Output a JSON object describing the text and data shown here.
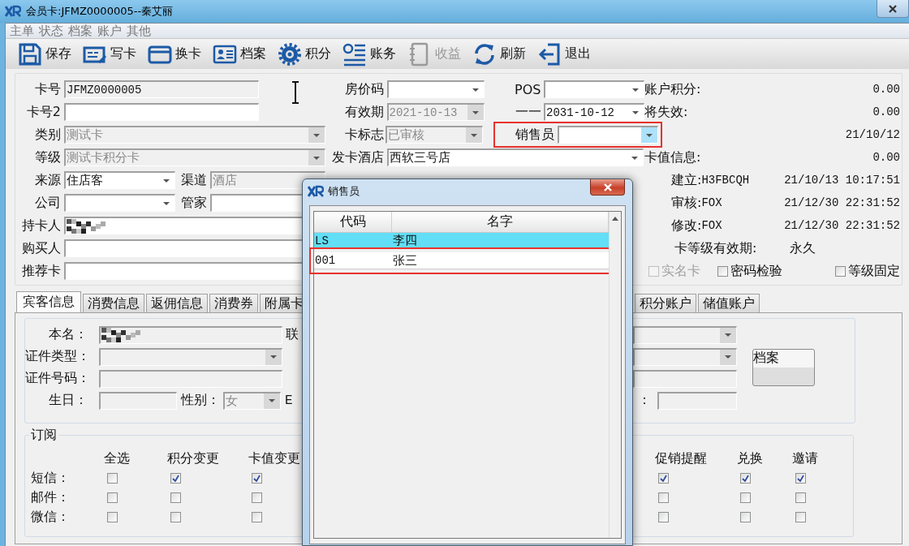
{
  "window": {
    "title": "会员卡:JFMZ0000005--秦艾丽"
  },
  "menu": [
    "主单",
    "状态",
    "档案",
    "账户",
    "其他"
  ],
  "toolbar": [
    {
      "label": "保存",
      "kind": "save",
      "disabled": false
    },
    {
      "label": "写卡",
      "kind": "write",
      "disabled": false
    },
    {
      "label": "换卡",
      "kind": "card",
      "disabled": false
    },
    {
      "label": "档案",
      "kind": "profile",
      "disabled": false
    },
    {
      "label": "积分",
      "kind": "points",
      "disabled": false
    },
    {
      "label": "账务",
      "kind": "ledger",
      "disabled": false
    },
    {
      "label": "收益",
      "kind": "income",
      "disabled": true
    },
    {
      "label": "刷新",
      "kind": "refresh",
      "disabled": false
    },
    {
      "label": "退出",
      "kind": "exit",
      "disabled": false
    }
  ],
  "form": {
    "card_no": {
      "label": "卡号",
      "value": "JFMZ0000005",
      "readonly": true
    },
    "card_no2": {
      "label": "卡号2"
    },
    "category": {
      "label": "类别",
      "value": "测试卡",
      "disabled": true
    },
    "grade": {
      "label": "等级",
      "value": "测试卡积分卡",
      "disabled": true
    },
    "source": {
      "label": "来源",
      "value": "住店客"
    },
    "channel": {
      "label": "渠道",
      "value": "酒店",
      "disabled": true
    },
    "company": {
      "label": "公司"
    },
    "butler": {
      "label": "管家"
    },
    "holder": {
      "label": "持卡人",
      "redacted": true
    },
    "buyer": {
      "label": "购买人"
    },
    "referrer": {
      "label": "推荐卡"
    },
    "room_rate": {
      "label": "房价码"
    },
    "valid_from": {
      "label": "有效期",
      "value": "2021-10-13",
      "disabled": true
    },
    "card_flag": {
      "label": "卡标志",
      "value": "已审核",
      "disabled": true
    },
    "hotel": {
      "label": "发卡酒店",
      "value": "西软三号店"
    },
    "pos": {
      "label": "POS"
    },
    "valid_to": {
      "label": "一一",
      "value": "2031-10-12"
    },
    "salesperson": {
      "label": "销售员",
      "focused": true,
      "highlighted": true
    }
  },
  "summary": [
    {
      "label": "账户积分:",
      "value": "0.00"
    },
    {
      "label": "将失效:",
      "value": "0.00"
    },
    {
      "value": "21/10/12"
    },
    {
      "label": "卡值信息:",
      "value": "0.00"
    }
  ],
  "audit": [
    {
      "label": "建立:",
      "user": "H3FBCQH",
      "time": "21/10/13 10:17:51"
    },
    {
      "label": "审核:",
      "user": "FOX",
      "time": "21/12/30 22:31:52"
    },
    {
      "label": "修改:",
      "user": "FOX",
      "time": "21/12/30 22:31:52"
    }
  ],
  "grade_validity": {
    "label": "卡等级有效期:",
    "value": "永久"
  },
  "options": [
    {
      "label": "实名卡",
      "checked": false,
      "disabled": true
    },
    {
      "label": "密码检验",
      "checked": false,
      "disabled": false
    },
    {
      "label": "等级固定",
      "checked": false,
      "disabled": false
    }
  ],
  "tabs": [
    {
      "label": "宾客信息",
      "selected": true
    },
    {
      "label": "消费信息",
      "selected": false
    },
    {
      "label": "返佣信息",
      "selected": false
    },
    {
      "label": "消费券",
      "selected": false
    },
    {
      "label": "附属卡",
      "selected": false
    },
    {
      "label": "积分账户",
      "selected": false
    },
    {
      "label": "储值账户",
      "selected": false
    }
  ],
  "guest": {
    "name": {
      "label": "本名：",
      "redacted": true,
      "disabled": true
    },
    "name_side_label": "联",
    "id_type": {
      "label": "证件类型：",
      "disabled": true
    },
    "id_no": {
      "label": "证件号码：",
      "disabled": true
    },
    "birthday": {
      "label": "生日：",
      "disabled": true
    },
    "gender": {
      "label": "性别：",
      "value": "女",
      "disabled": true
    },
    "gender_side_label": "E",
    "right_fields": [
      {
        "kind": "combo",
        "disabled": true
      },
      {
        "kind": "combo",
        "disabled": true
      },
      {
        "kind": "text",
        "disabled": true
      },
      {
        "kind": "text",
        "label": "：",
        "disabled": true
      }
    ],
    "button": "档案"
  },
  "subscription": {
    "title": "订阅",
    "columns": [
      "全选",
      "积分变更",
      "卡值变更",
      "促销提醒",
      "兑换",
      "邀请"
    ],
    "rows": [
      {
        "label": "短信：",
        "checks": [
          {
            "checked": false
          },
          {
            "checked": true
          },
          {
            "checked": true
          },
          {
            "checked": true
          },
          {
            "checked": true
          },
          {
            "checked": true
          }
        ]
      },
      {
        "label": "邮件：",
        "checks": [
          {
            "checked": false
          },
          {
            "checked": false
          },
          {
            "checked": false
          },
          {
            "checked": false
          },
          {
            "checked": false
          },
          {
            "checked": false
          }
        ]
      },
      {
        "label": "微信：",
        "checks": [
          {
            "checked": false
          },
          {
            "checked": false
          },
          {
            "checked": false
          },
          {
            "checked": false
          },
          {
            "checked": false
          },
          {
            "checked": false
          }
        ]
      }
    ]
  },
  "dialog": {
    "title": "销售员",
    "columns": [
      "代码",
      "名字"
    ],
    "rows": [
      {
        "code": "LS",
        "name": "李四",
        "selected": true,
        "highlighted": false
      },
      {
        "code": "001",
        "name": "张三",
        "selected": false,
        "highlighted": true
      }
    ]
  }
}
